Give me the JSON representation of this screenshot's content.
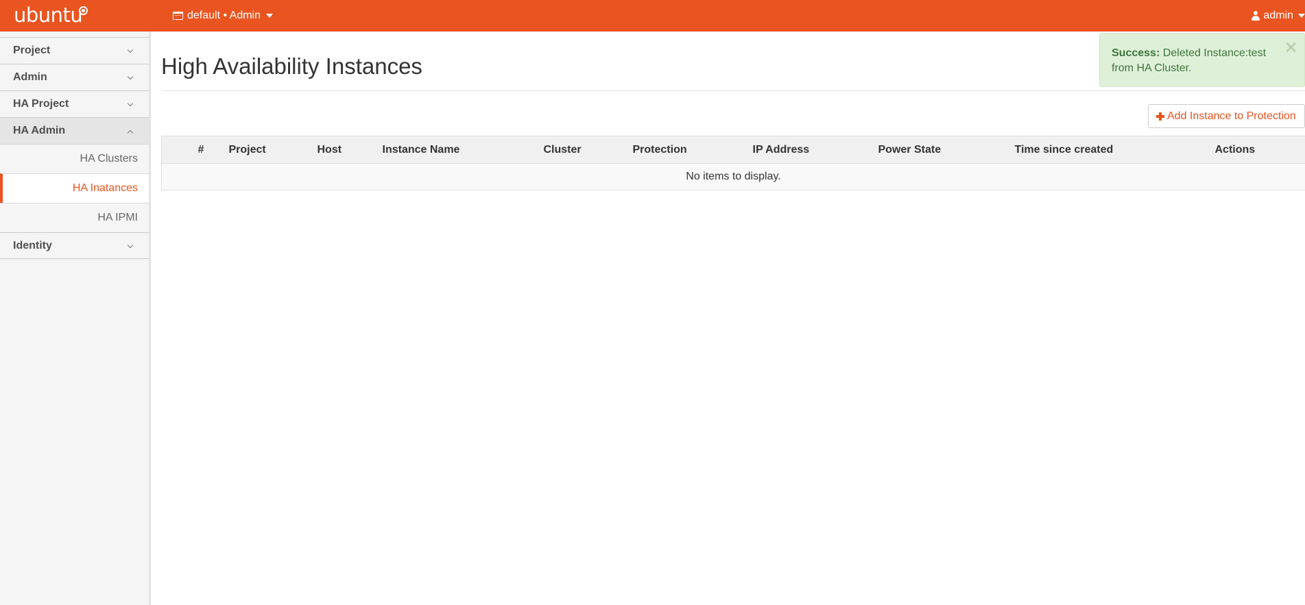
{
  "navbar": {
    "brand": "ubuntu",
    "project_switcher": {
      "icon": "calendar-icon",
      "label": "default • Admin"
    },
    "user_menu": {
      "icon": "user-icon",
      "label": "admin"
    },
    "background_color": "#e95420"
  },
  "sidebar": {
    "groups": [
      {
        "label": "Project",
        "expanded": false
      },
      {
        "label": "Admin",
        "expanded": false
      },
      {
        "label": "HA Project",
        "expanded": false
      },
      {
        "label": "HA Admin",
        "expanded": true,
        "items": [
          {
            "label": "HA Clusters",
            "active": false
          },
          {
            "label": "HA Inatances",
            "active": true
          },
          {
            "label": "HA IPMI",
            "active": false
          }
        ]
      },
      {
        "label": "Identity",
        "expanded": false
      }
    ],
    "active_color": "#e95420"
  },
  "main": {
    "page_title": "High Availability Instances",
    "add_button": {
      "icon": "plus-icon",
      "label": "Add Instance to Protection"
    },
    "table": {
      "columns": [
        "#",
        "Project",
        "Host",
        "Instance Name",
        "Cluster",
        "Protection",
        "IP Address",
        "Power State",
        "Time since created",
        "Actions"
      ],
      "rows": [],
      "empty_message": "No items to display."
    }
  },
  "alert": {
    "type": "success",
    "title": "Success:",
    "message": " Deleted Instance:test from HA Cluster.",
    "close_icon": "close-icon",
    "background_color": "#dff0d8",
    "text_color": "#3c763d"
  }
}
